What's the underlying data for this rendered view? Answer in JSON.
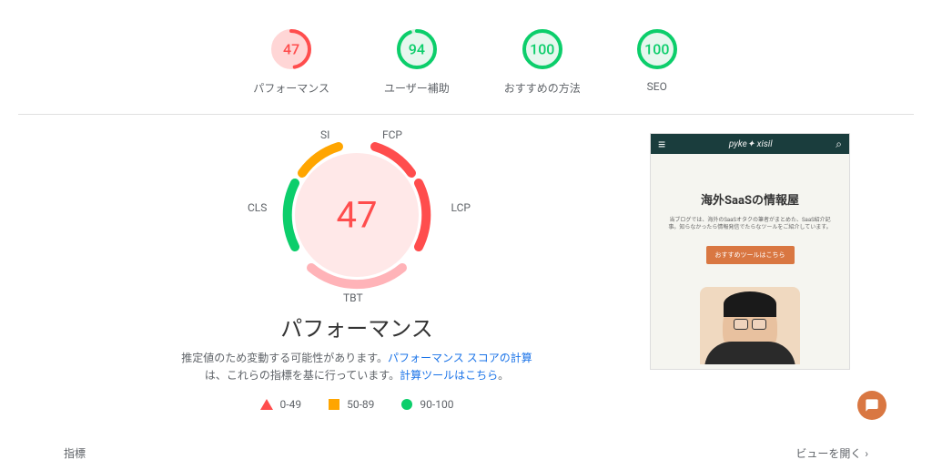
{
  "top_scores": {
    "performance": {
      "value": "47",
      "label": "パフォーマンス",
      "color": "#ff4d4d",
      "bg": "#ffd6d6",
      "percent": 47
    },
    "accessibility": {
      "value": "94",
      "label": "ユーザー補助",
      "color": "#0cce6b",
      "bg": "#e6f7ee",
      "percent": 94
    },
    "best_practices": {
      "value": "100",
      "label": "おすすめの方法",
      "color": "#0cce6b",
      "bg": "#e6f7ee",
      "percent": 100
    },
    "seo": {
      "value": "100",
      "label": "SEO",
      "color": "#0cce6b",
      "bg": "#e6f7ee",
      "percent": 100
    }
  },
  "main_gauge": {
    "score": "47",
    "title": "パフォーマンス",
    "metrics": {
      "si": "SI",
      "fcp": "FCP",
      "lcp": "LCP",
      "cls": "CLS",
      "tbt": "TBT"
    },
    "desc1": "推定値のため変動する可能性があります。",
    "link1": "パフォーマンス スコアの計算",
    "desc2": "は、これらの指標を基に行っています。",
    "link2": "計算ツールはこちら",
    "period": "。"
  },
  "legend": {
    "bad": "0-49",
    "mid": "50-89",
    "good": "90-100"
  },
  "preview": {
    "logo": "pyke✦ xisil",
    "title": "海外SaaSの情報屋",
    "subtitle": "当ブログでは、海外のSaaSオタクの筆者がまとめた、SaaS紹介記事。知らなかったら情報発信でたらなツールをご紹介しています。",
    "button": "おすすめツールはこちら"
  },
  "bottom": {
    "metrics_label": "指標",
    "expand_label": "ビューを開く"
  }
}
